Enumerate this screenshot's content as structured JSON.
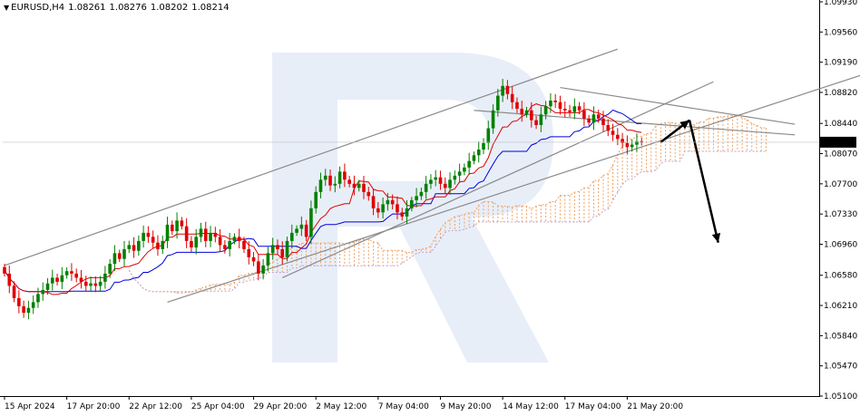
{
  "header": {
    "symbol": "EURUSD,H4",
    "open": "1.08261",
    "high": "1.08276",
    "low": "1.08202",
    "close": "1.08214"
  },
  "current_price_tag": "1.08214",
  "colors": {
    "bull": "#008000",
    "bear": "#e00000",
    "tenkan": "#e00000",
    "kijun": "#0000dd",
    "cloud_bull": "#f0a060",
    "cloud_bear": "#c0a0d0",
    "trendline": "#8a8a8a",
    "arrow": "#000000",
    "watermark": "#e8eef8"
  },
  "chart_data": {
    "type": "candlestick",
    "symbol": "EURUSD",
    "timeframe": "H4",
    "ylim": [
      1.051,
      1.0993
    ],
    "y_ticks": [
      "1.09930",
      "1.09560",
      "1.09190",
      "1.08820",
      "1.08440",
      "1.08070",
      "1.07700",
      "1.07330",
      "1.06960",
      "1.06580",
      "1.06210",
      "1.05840",
      "1.05470",
      "1.05100"
    ],
    "x_ticks": [
      "15 Apr 2024",
      "17 Apr 20:00",
      "22 Apr 12:00",
      "25 Apr 04:00",
      "29 Apr 20:00",
      "2 May 12:00",
      "7 May 04:00",
      "9 May 20:00",
      "14 May 12:00",
      "17 May 04:00",
      "21 May 20:00"
    ],
    "x_tick_index": [
      0,
      13,
      26,
      39,
      52,
      65,
      78,
      91,
      104,
      117,
      130
    ],
    "n_bars": 140,
    "closes": [
      1.066,
      1.0645,
      1.063,
      1.062,
      1.0612,
      1.0618,
      1.0625,
      1.0635,
      1.064,
      1.0648,
      1.0655,
      1.065,
      1.0658,
      1.0663,
      1.066,
      1.0655,
      1.065,
      1.0645,
      1.0648,
      1.0645,
      1.065,
      1.066,
      1.0672,
      1.0685,
      1.0678,
      1.069,
      1.0695,
      1.0688,
      1.07,
      1.071,
      1.0705,
      1.0698,
      1.069,
      1.07,
      1.072,
      1.0712,
      1.0725,
      1.0718,
      1.07,
      1.0692,
      1.0705,
      1.0715,
      1.07,
      1.071,
      1.0705,
      1.0695,
      1.069,
      1.07,
      1.0705,
      1.07,
      1.069,
      1.068,
      1.0675,
      1.066,
      1.067,
      1.0685,
      1.0695,
      1.069,
      1.068,
      1.07,
      1.071,
      1.0715,
      1.072,
      1.0705,
      1.074,
      1.076,
      1.0775,
      1.078,
      1.0768,
      1.077,
      1.0785,
      1.0775,
      1.077,
      1.0765,
      1.077,
      1.076,
      1.0755,
      1.074,
      1.0735,
      1.0745,
      1.075,
      1.0745,
      1.0735,
      1.073,
      1.074,
      1.075,
      1.0755,
      1.076,
      1.077,
      1.0775,
      1.0778,
      1.077,
      1.0765,
      1.0775,
      1.078,
      1.0785,
      1.079,
      1.0798,
      1.0805,
      1.0812,
      1.082,
      1.0838,
      1.086,
      1.0878,
      1.089,
      1.088,
      1.087,
      1.0862,
      1.0855,
      1.086,
      1.0848,
      1.0842,
      1.0855,
      1.0865,
      1.0872,
      1.087,
      1.0862,
      1.086,
      1.0858,
      1.0865,
      1.086,
      1.085,
      1.0845,
      1.0855,
      1.085,
      1.0842,
      1.0835,
      1.083,
      1.0825,
      1.082,
      1.0815,
      1.0818,
      1.0822,
      1.0821
    ],
    "projection_arrows": [
      {
        "from": [
          137,
          1.0821
        ],
        "to": [
          143,
          1.0848
        ]
      },
      {
        "from": [
          143,
          1.0848
        ],
        "to": [
          149,
          1.0698
        ]
      }
    ],
    "trendlines": [
      {
        "from": [
          0,
          1.067
        ],
        "to": [
          128,
          1.0935
        ]
      },
      {
        "from": [
          34,
          1.0625
        ],
        "to": [
          185,
          1.0915
        ]
      },
      {
        "from": [
          58,
          1.0655
        ],
        "to": [
          148,
          1.0895
        ]
      },
      {
        "from": [
          98,
          1.086
        ],
        "to": [
          165,
          1.083
        ]
      },
      {
        "from": [
          116,
          1.0888
        ],
        "to": [
          165,
          1.0843
        ]
      }
    ]
  }
}
